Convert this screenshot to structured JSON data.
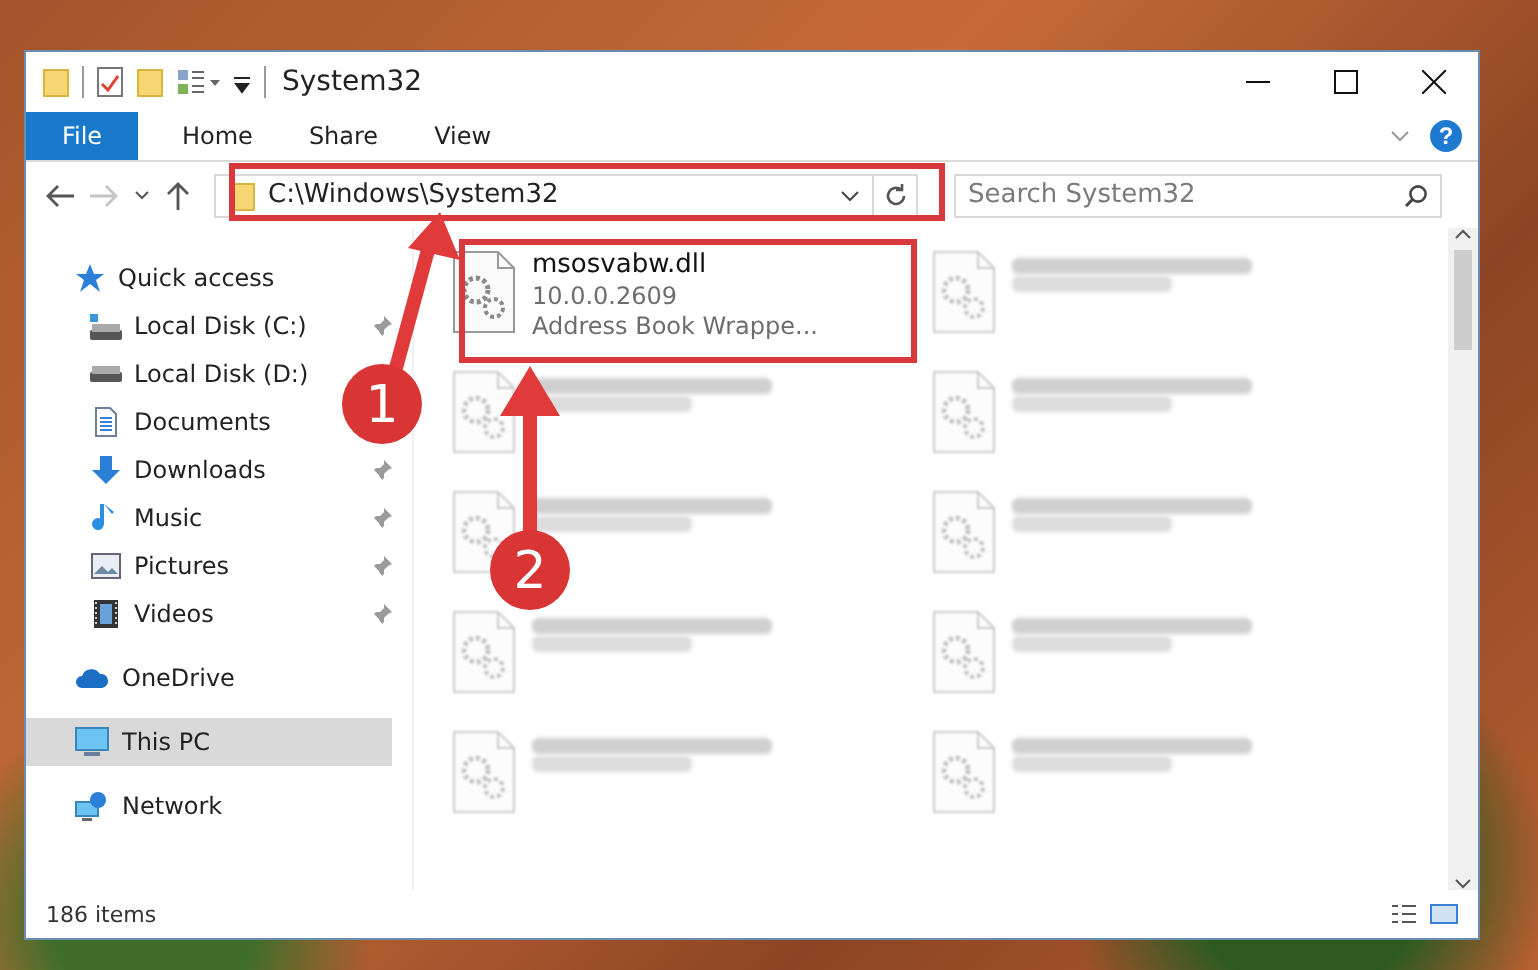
{
  "window": {
    "title": "System32"
  },
  "ribbon": {
    "tabs": [
      {
        "label": "File",
        "kind": "file"
      },
      {
        "label": "Home",
        "kind": "tab"
      },
      {
        "label": "Share",
        "kind": "tab"
      },
      {
        "label": "View",
        "kind": "tab"
      }
    ],
    "help": "?"
  },
  "address": {
    "path": "C:\\Windows\\System32"
  },
  "search": {
    "placeholder": "Search System32"
  },
  "sidebar": {
    "items": [
      {
        "label": "Quick access",
        "kind": "star",
        "selected": false,
        "pinned": false,
        "children": [
          {
            "label": "Local Disk (C:)",
            "kind": "system-drive",
            "selected": false,
            "pinned": true
          },
          {
            "label": "Local Disk (D:)",
            "kind": "drive",
            "selected": false,
            "pinned": false
          },
          {
            "label": "Documents",
            "kind": "documents",
            "selected": false,
            "pinned": false
          },
          {
            "label": "Downloads",
            "kind": "downloads",
            "selected": false,
            "pinned": true
          },
          {
            "label": "Music",
            "kind": "music",
            "selected": false,
            "pinned": true
          },
          {
            "label": "Pictures",
            "kind": "pictures",
            "selected": false,
            "pinned": true
          },
          {
            "label": "Videos",
            "kind": "videos",
            "selected": false,
            "pinned": true
          }
        ]
      },
      {
        "label": "OneDrive",
        "kind": "cloud",
        "selected": false,
        "pinned": false
      },
      {
        "label": "This PC",
        "kind": "computer",
        "selected": true,
        "pinned": false
      },
      {
        "label": "Network",
        "kind": "network",
        "selected": false,
        "pinned": false
      }
    ]
  },
  "files": [
    {
      "name": "msosvabw.dll",
      "details": [
        "10.0.0.2609",
        "Address Book Wrappe..."
      ],
      "blurred": false
    },
    {
      "blurred": true
    },
    {
      "blurred": true
    },
    {
      "blurred": true
    },
    {
      "blurred": true
    },
    {
      "blurred": true
    },
    {
      "blurred": true
    },
    {
      "blurred": true
    },
    {
      "blurred": true
    },
    {
      "blurred": true
    }
  ],
  "status_bar": {
    "count": "186 items"
  },
  "annotations": [
    {
      "label": "1"
    },
    {
      "label": "2"
    }
  ]
}
